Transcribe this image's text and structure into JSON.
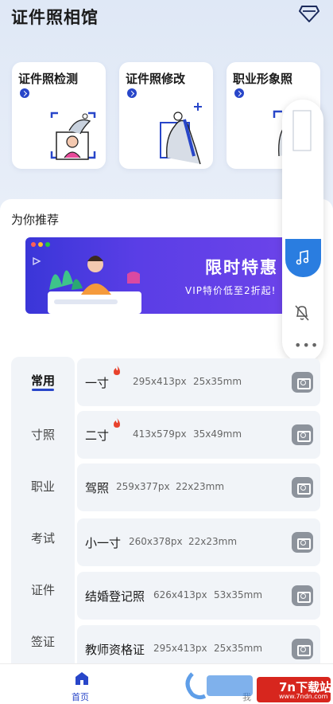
{
  "app": {
    "title": "证件照相馆"
  },
  "cards": [
    {
      "title": "证件照检测"
    },
    {
      "title": "证件照修改"
    },
    {
      "title": "职业形象照"
    }
  ],
  "recommend": {
    "title": "为你推荐"
  },
  "banner": {
    "main_text": "限时特惠",
    "sub_text": "VIP特价低至2折起!"
  },
  "categories": [
    "常用",
    "寸照",
    "职业",
    "考试",
    "证件",
    "签证"
  ],
  "active_category": "常用",
  "rows": [
    {
      "name": "一寸",
      "px": "295x413px",
      "mm": "25x35mm",
      "hot": true
    },
    {
      "name": "二寸",
      "px": "413x579px",
      "mm": "35x49mm",
      "hot": true
    },
    {
      "name": "驾照",
      "px": "259x377px",
      "mm": "22x23mm",
      "hot": false
    },
    {
      "name": "小一寸",
      "px": "260x378px",
      "mm": "22x23mm",
      "hot": false
    },
    {
      "name": "结婚登记照",
      "px": "626x413px",
      "mm": "53x35mm",
      "hot": false
    },
    {
      "name": "教师资格证",
      "px": "295x413px",
      "mm": "25x35mm",
      "hot": false
    }
  ],
  "bottom_nav": {
    "home_label": "首页",
    "mine_label": "我"
  },
  "watermark": {
    "main": "7n下载站",
    "sub": "www.7ndn.com"
  },
  "colors": {
    "accent": "#2846c9",
    "banner": "#4a3ae0",
    "music": "#2a7de0",
    "fire": "#e8422c"
  },
  "icons": [
    "diamond-icon",
    "arrow-right-icon",
    "music-icon",
    "bell-off-icon",
    "more-icon",
    "camera-icon",
    "fire-icon",
    "home-icon"
  ]
}
